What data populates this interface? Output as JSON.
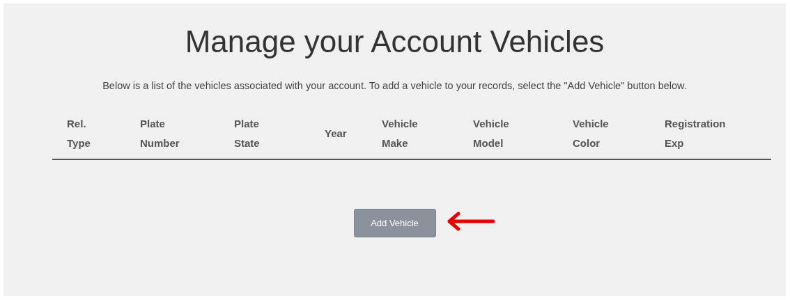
{
  "title": "Manage your Account Vehicles",
  "intro": "Below is a list of the vehicles associated with your account. To add a vehicle to your records, select the \"Add Vehicle\" button below.",
  "table": {
    "columns": [
      "Rel. Type",
      "Plate Number",
      "Plate State",
      "Year",
      "Vehicle Make",
      "Vehicle Model",
      "Vehicle Color",
      "Registration Exp"
    ]
  },
  "add_button": "Add Vehicle"
}
